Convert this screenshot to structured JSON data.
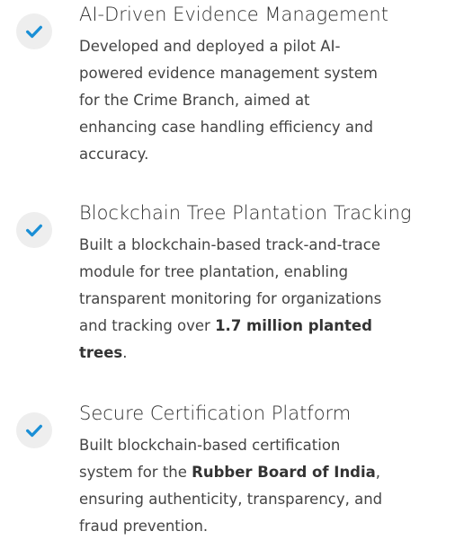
{
  "theme": {
    "accent": "#1a8fd6",
    "badge_bg": "#eeeeee",
    "title_color": "#2f2f2f",
    "text_color": "#444444"
  },
  "features": [
    {
      "icon": "check-icon",
      "title": "AI-Driven Evidence Management",
      "lines": [
        [
          {
            "text": "Developed and deployed a pilot AI-"
          }
        ],
        [
          {
            "text": "powered evidence management system"
          }
        ],
        [
          {
            "text": "for the Crime Branch, aimed at"
          }
        ],
        [
          {
            "text": "enhancing case handling efficiency and"
          }
        ],
        [
          {
            "text": "accuracy."
          }
        ]
      ]
    },
    {
      "icon": "check-icon",
      "title": "Blockchain Tree Plantation Tracking",
      "lines": [
        [
          {
            "text": "Built a blockchain-based track-and-trace"
          }
        ],
        [
          {
            "text": "module for tree plantation, enabling"
          }
        ],
        [
          {
            "text": "transparent monitoring for organizations"
          }
        ],
        [
          {
            "text": "and tracking over "
          },
          {
            "text": "1.7 million planted",
            "bold": true
          }
        ],
        [
          {
            "text": "trees",
            "bold": true
          },
          {
            "text": "."
          }
        ]
      ]
    },
    {
      "icon": "check-icon",
      "title": "Secure Certification Platform",
      "lines": [
        [
          {
            "text": "Built blockchain-based certification"
          }
        ],
        [
          {
            "text": "system for the "
          },
          {
            "text": "Rubber Board of India",
            "bold": true
          },
          {
            "text": ","
          }
        ],
        [
          {
            "text": "ensuring authenticity, transparency, and"
          }
        ],
        [
          {
            "text": "fraud prevention."
          }
        ]
      ]
    }
  ]
}
